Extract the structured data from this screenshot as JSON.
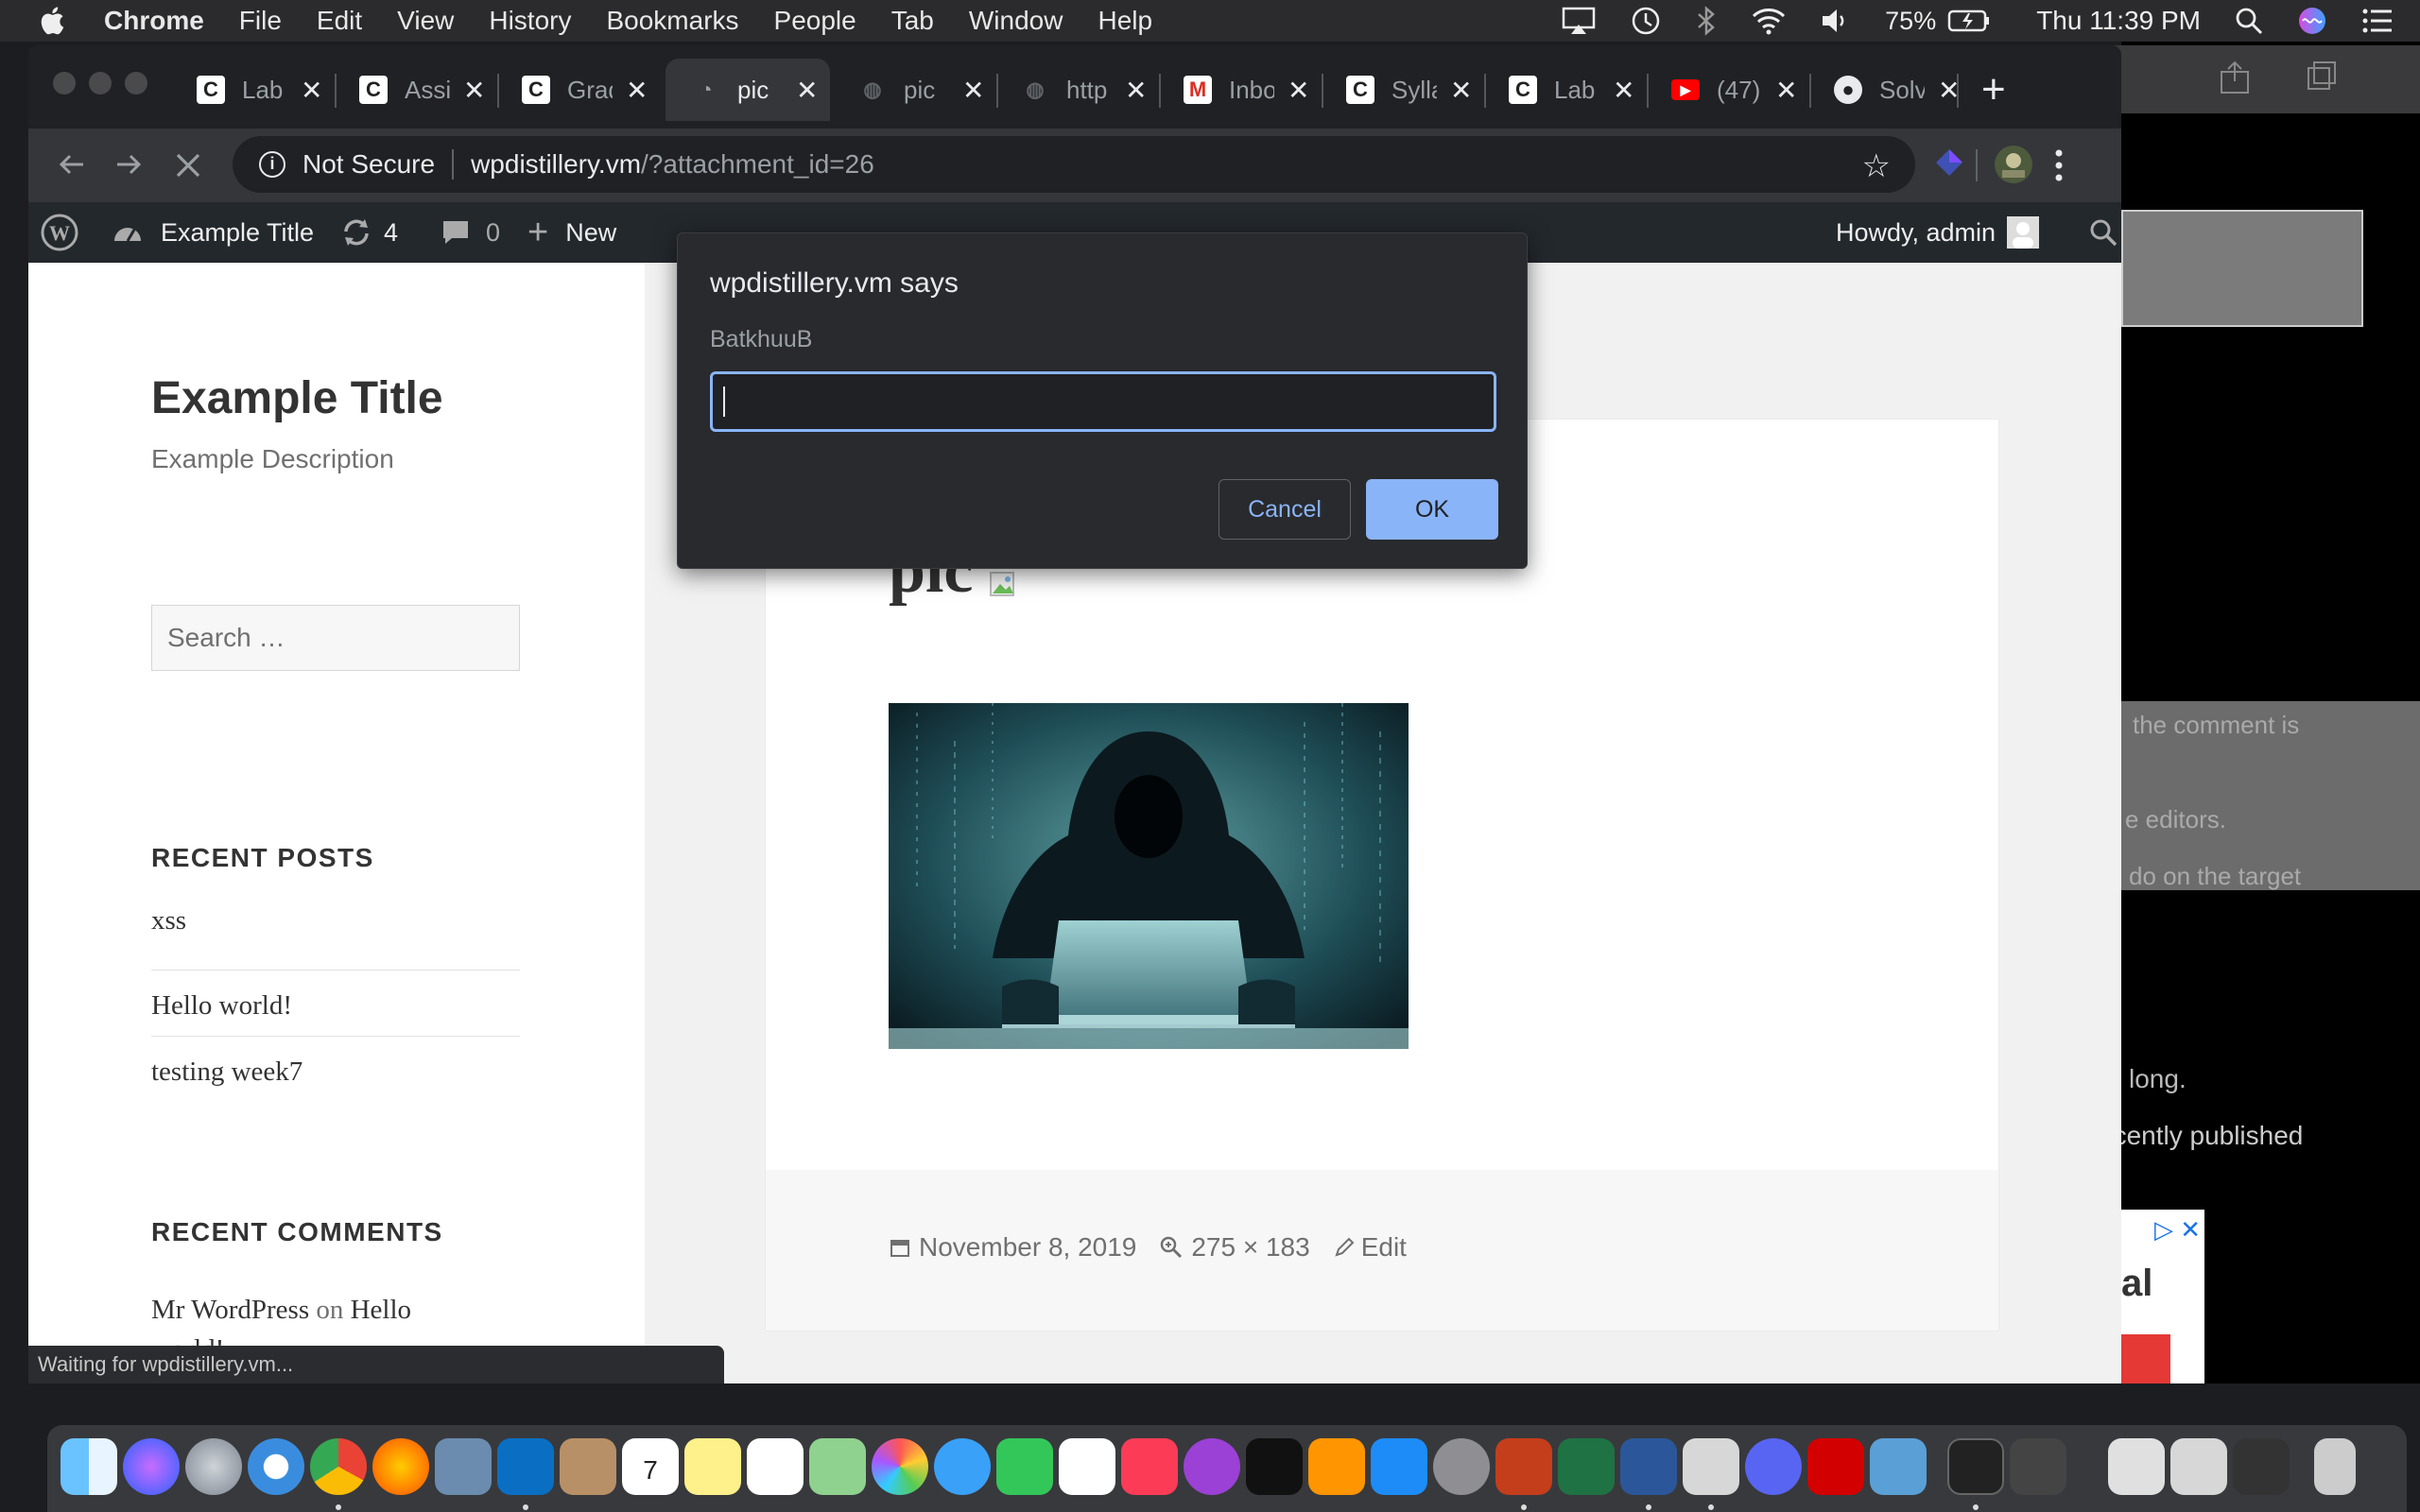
{
  "menubar": {
    "app": "Chrome",
    "items": [
      "File",
      "Edit",
      "View",
      "History",
      "Bookmarks",
      "People",
      "Tab",
      "Window",
      "Help"
    ],
    "battery": "75%",
    "clock": "Thu 11:39 PM"
  },
  "tabs": [
    {
      "title": "Lab",
      "favicon": "c-icon"
    },
    {
      "title": "Assi",
      "favicon": "c-icon"
    },
    {
      "title": "Grad",
      "favicon": "c-icon"
    },
    {
      "title": "pic",
      "favicon": "loading-icon",
      "active": true
    },
    {
      "title": "pic",
      "favicon": "globe-icon"
    },
    {
      "title": "http",
      "favicon": "globe-icon"
    },
    {
      "title": "Inbo",
      "favicon": "gmail-icon"
    },
    {
      "title": "Sylla",
      "favicon": "c-icon"
    },
    {
      "title": "Lab",
      "favicon": "c-icon"
    },
    {
      "title": "(47)",
      "favicon": "youtube-icon"
    },
    {
      "title": "Solv",
      "favicon": "github-icon"
    }
  ],
  "omnibox": {
    "security": "Not Secure",
    "host": "wpdistillery.vm",
    "path": "/?attachment_id=26"
  },
  "adminbar": {
    "site": "Example Title",
    "updates": "4",
    "comments": "0",
    "new": "New",
    "howdy": "Howdy, admin"
  },
  "sidebar": {
    "title": "Example Title",
    "description": "Example Description",
    "search_placeholder": "Search …",
    "recent_posts_title": "RECENT POSTS",
    "recent_posts": [
      "xss",
      "Hello world!",
      "testing week7"
    ],
    "recent_comments_title": "RECENT COMMENTS",
    "comment_author": "Mr WordPress",
    "comment_on": "on",
    "comment_post_a": "Hello",
    "comment_post_b": "world!"
  },
  "article": {
    "title": "pic",
    "date": "November 8, 2019",
    "dimensions": "275 × 183",
    "edit": "Edit"
  },
  "dialog": {
    "title": "wpdistillery.vm says",
    "message": "BatkhuuB",
    "input_value": "",
    "cancel": "Cancel",
    "ok": "OK"
  },
  "status": "Waiting for wpdistillery.vm...",
  "background": {
    "text_a": "the comment is",
    "text_b": "e editors.",
    "text_c": "do on the target",
    "text_d": "long.",
    "text_e": "ecently published",
    "ad_text": "al"
  },
  "colors": {
    "accent": "#8ab4f8",
    "adminbar": "#23282d",
    "tabstrip": "#202124"
  }
}
